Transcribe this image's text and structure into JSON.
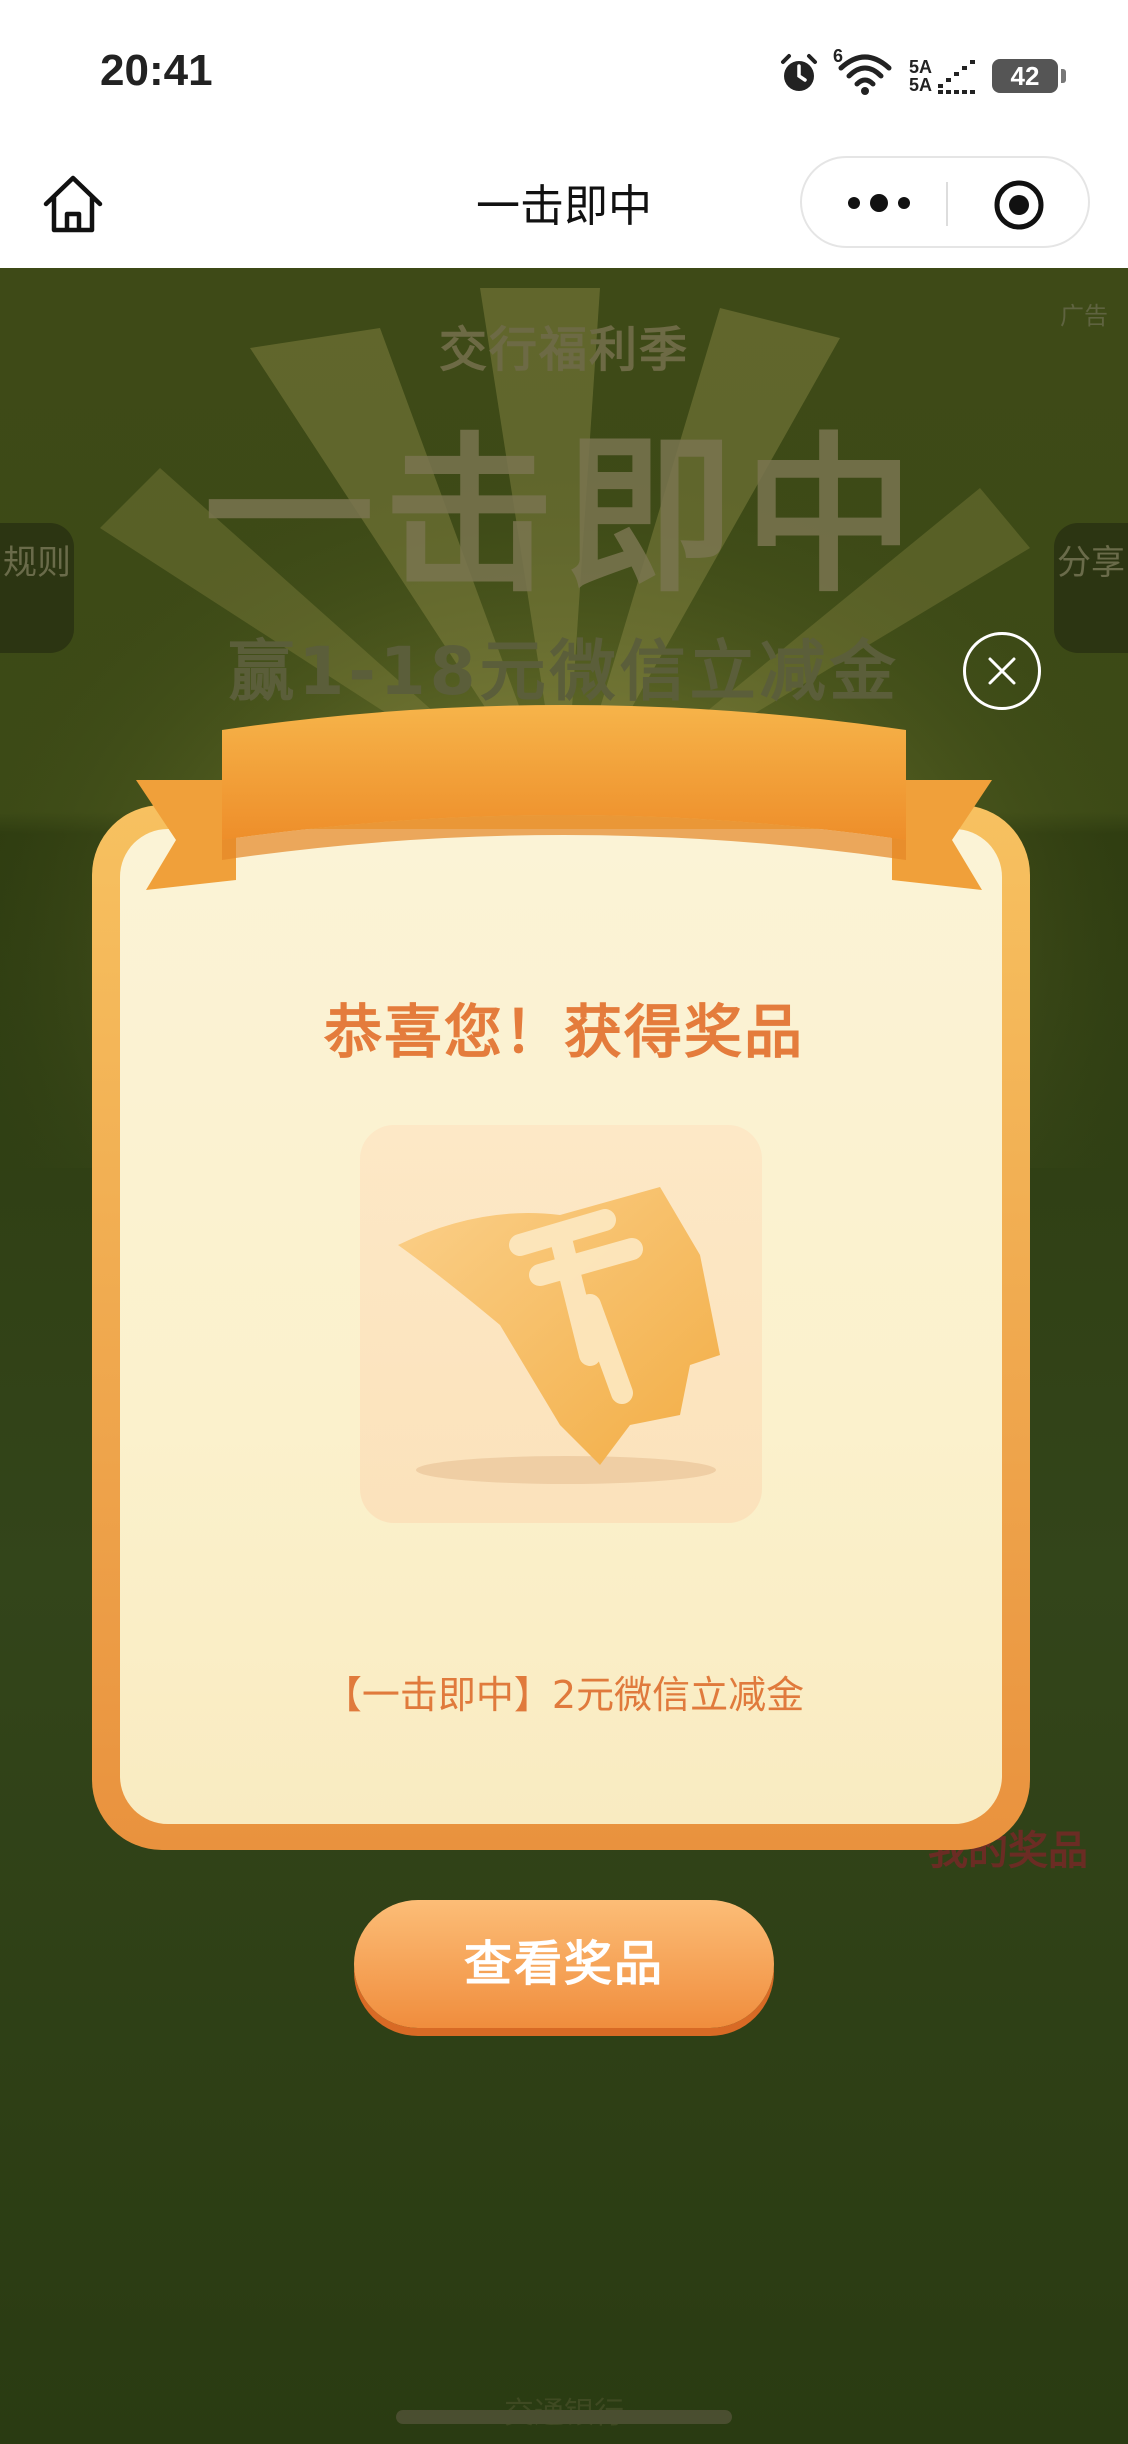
{
  "status_bar": {
    "time": "20:41",
    "network_top": "5A",
    "network_bottom": "5A",
    "wifi_badge": "6",
    "battery": "42",
    "icons": [
      "alarm-icon",
      "wifi-icon",
      "signal-icon",
      "battery-icon"
    ]
  },
  "nav": {
    "title": "一击即中"
  },
  "background": {
    "brand": "交行福利季",
    "big_title": "一击即中",
    "subtitle": "赢1-18元微信立减金",
    "ad_label": "广告",
    "rules_tab": "规则",
    "share_tab": "分享",
    "my_prize": "我的奖品",
    "footer": "— 交通银行 —"
  },
  "modal": {
    "congrats": "恭喜您！获得奖品",
    "prize_name": "【一击即中】2元微信立减金",
    "view_button": "查看奖品"
  },
  "colors": {
    "accent_orange": "#e47c3c",
    "button_orange": "#f08d3d",
    "card_border": "#f7c160"
  }
}
